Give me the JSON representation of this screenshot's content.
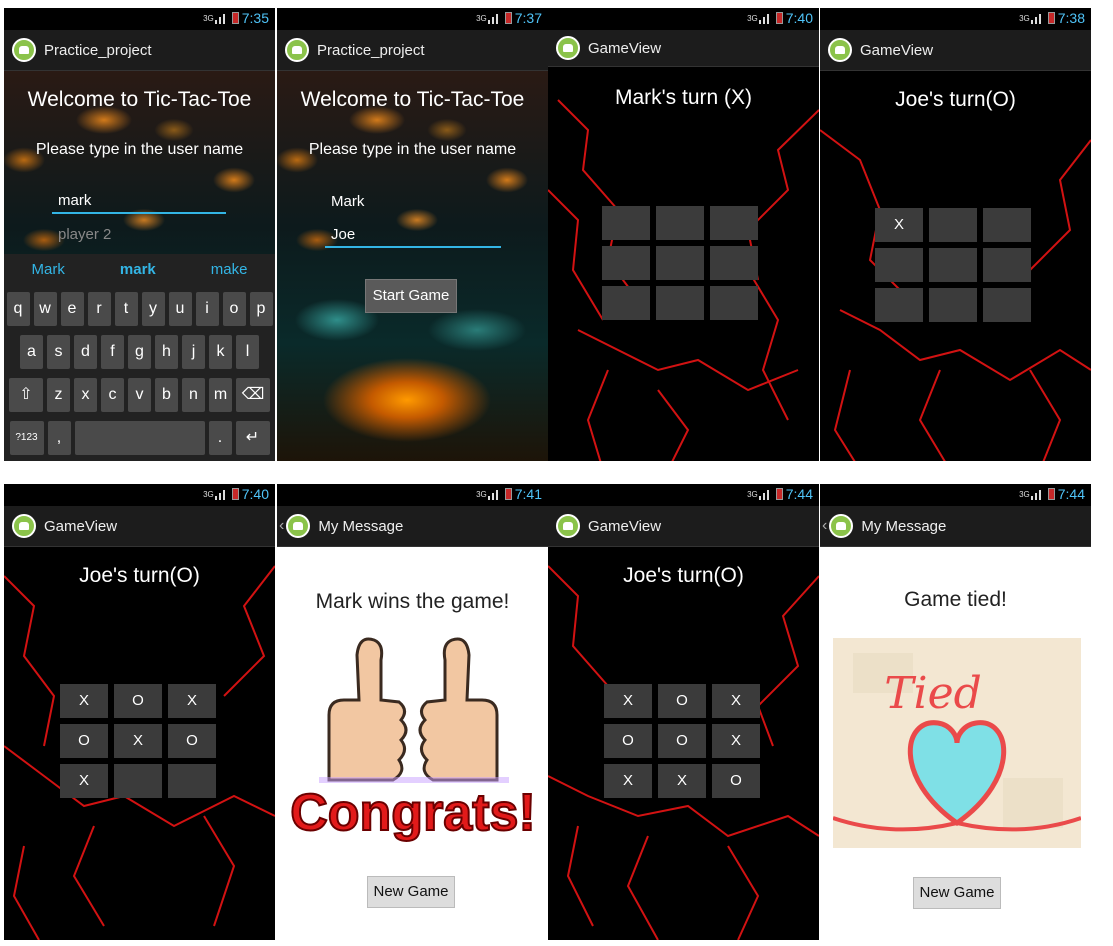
{
  "status_times": [
    "7:35",
    "7:37",
    "7:40",
    "7:38",
    "7:40",
    "7:41",
    "7:44",
    "7:44"
  ],
  "network": "3G",
  "screens": {
    "s1": {
      "app_title": "Practice_project",
      "welcome": "Welcome to Tic-Tac-Toe",
      "prompt": "Please type in the user name",
      "player1_value": "mark",
      "player2_placeholder": "player 2",
      "suggestions": [
        "Mark",
        "mark",
        "make"
      ],
      "keys_row1": [
        "q",
        "w",
        "e",
        "r",
        "t",
        "y",
        "u",
        "i",
        "o",
        "p"
      ],
      "keys_row2": [
        "a",
        "s",
        "d",
        "f",
        "g",
        "h",
        "j",
        "k",
        "l"
      ],
      "keys_row3": [
        "z",
        "x",
        "c",
        "v",
        "b",
        "n",
        "m"
      ],
      "shift_key": "⇧",
      "backspace_key": "⌫",
      "sym_key": "?123",
      "comma_key": ",",
      "period_key": ".",
      "enter_key": "↵"
    },
    "s2": {
      "app_title": "Practice_project",
      "welcome": "Welcome to Tic-Tac-Toe",
      "prompt": "Please type in the user name",
      "player1_value": "Mark",
      "player2_value": "Joe",
      "start_button": "Start Game"
    },
    "s3": {
      "app_title": "GameView",
      "turn": "Mark's turn (X)",
      "board": [
        "",
        "",
        "",
        "",
        "",
        "",
        "",
        "",
        ""
      ]
    },
    "s4": {
      "app_title": "GameView",
      "turn": "Joe's turn(O)",
      "board": [
        "X",
        "",
        "",
        "",
        "",
        "",
        "",
        "",
        ""
      ]
    },
    "s5": {
      "app_title": "GameView",
      "turn": "Joe's turn(O)",
      "board": [
        "X",
        "O",
        "X",
        "O",
        "X",
        "O",
        "X",
        "",
        ""
      ]
    },
    "s6": {
      "app_title": "My Message",
      "message": "Mark wins the game!",
      "image_caption": "Congrats!",
      "button": "New Game"
    },
    "s7": {
      "app_title": "GameView",
      "turn": "Joe's turn(O)",
      "board": [
        "X",
        "O",
        "X",
        "O",
        "O",
        "X",
        "X",
        "X",
        "O"
      ]
    },
    "s8": {
      "app_title": "My Message",
      "message": "Game tied!",
      "image_caption": "Tied",
      "button": "New Game"
    }
  },
  "colors": {
    "accent": "#33b5e5",
    "lightning": "#e01010",
    "action_bar": "#1c1c1c"
  }
}
